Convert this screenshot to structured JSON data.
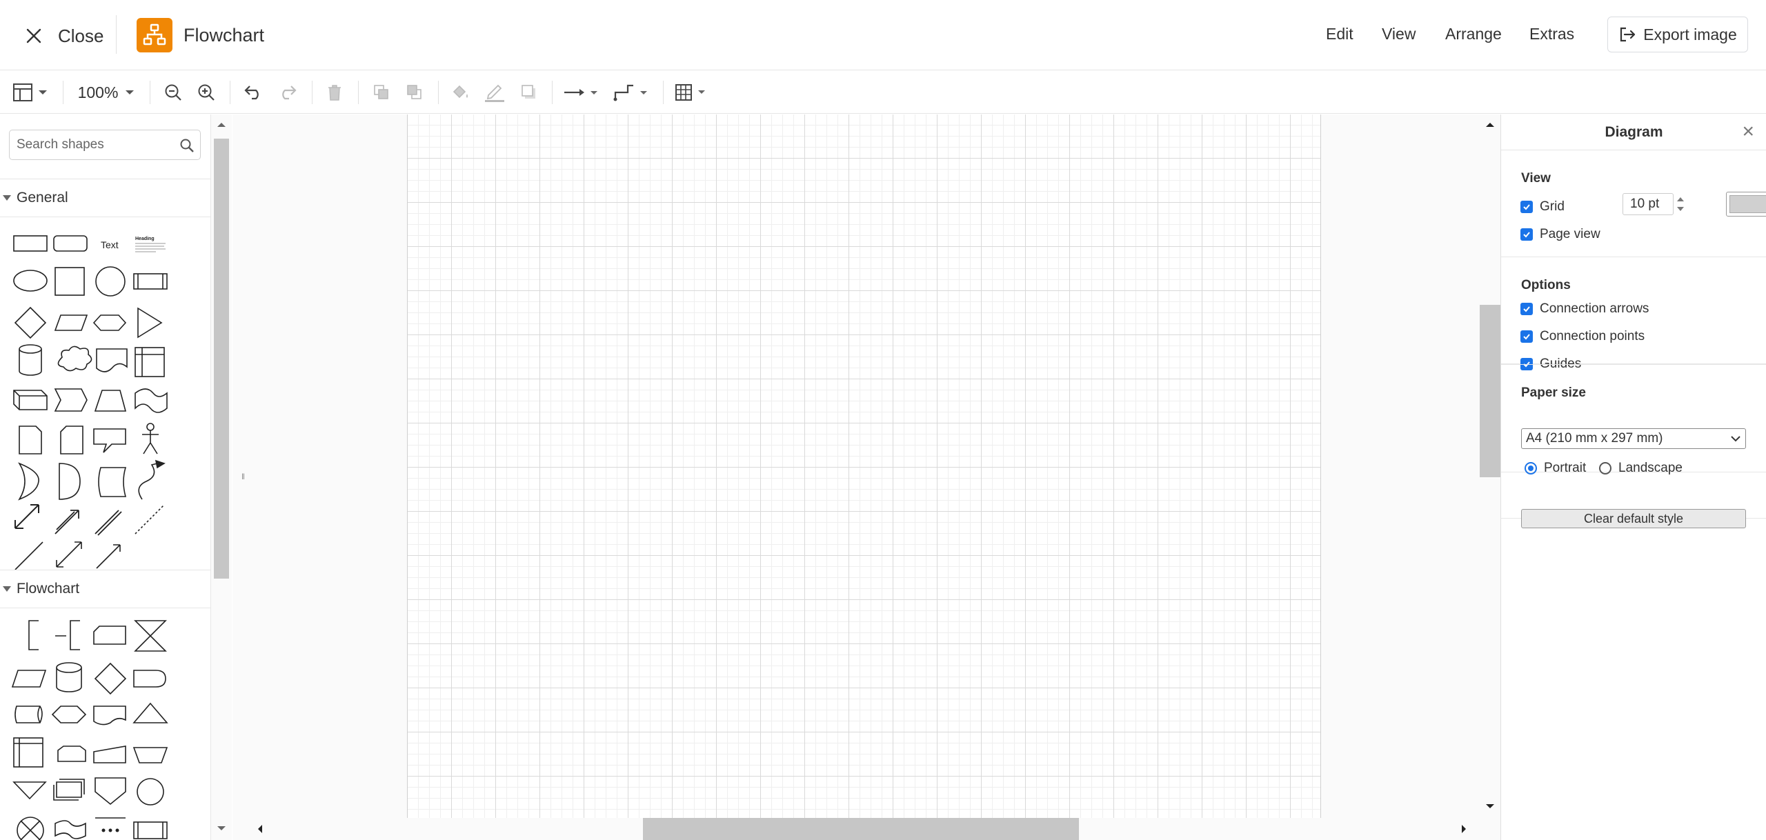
{
  "header": {
    "close_label": "Close",
    "title": "Flowchart",
    "menus": [
      "Edit",
      "View",
      "Arrange",
      "Extras"
    ],
    "export_label": "Export image"
  },
  "toolbar": {
    "zoom": "100%"
  },
  "sidebar": {
    "search_placeholder": "Search shapes",
    "sections": [
      {
        "label": "General"
      },
      {
        "label": "Flowchart"
      }
    ],
    "text_shape_label": "Text",
    "heading_shape_label": "Heading"
  },
  "format_panel": {
    "title": "Diagram",
    "view_heading": "View",
    "grid_label": "Grid",
    "grid_size": "10 pt",
    "page_view_label": "Page view",
    "options_heading": "Options",
    "connection_arrows_label": "Connection arrows",
    "connection_points_label": "Connection points",
    "guides_label": "Guides",
    "paper_size_heading": "Paper size",
    "paper_size_value": "A4 (210 mm x 297 mm)",
    "portrait_label": "Portrait",
    "landscape_label": "Landscape",
    "orientation_selected": "Portrait",
    "clear_style_label": "Clear default style"
  },
  "colors": {
    "accent": "#1a73e8",
    "logo": "#f08705"
  }
}
